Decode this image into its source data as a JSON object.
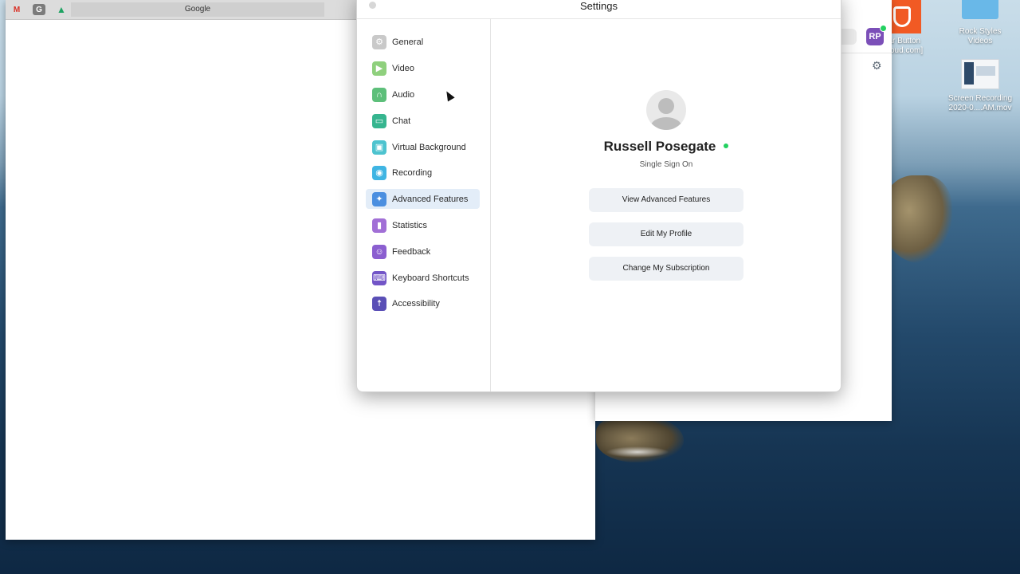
{
  "browser": {
    "bookmarks": [
      {
        "name": "gmail",
        "glyph": "M"
      },
      {
        "name": "g-app",
        "glyph": "G"
      },
      {
        "name": "drive",
        "glyph": "▲"
      }
    ],
    "tab_label": "Google"
  },
  "zoom_main": {
    "avatar_initials": "RP"
  },
  "desktop": {
    "icons": [
      {
        "label": "gar Button\n....oud.com]"
      },
      {
        "label": "Rock Styles\nVideos"
      },
      {
        "label": "Screen Recording\n2020-0....AM.mov"
      }
    ]
  },
  "settings": {
    "title": "Settings",
    "nav": [
      {
        "label": "General",
        "icon": "gear-icon",
        "color": "#c9c9c9",
        "glyph": "⚙"
      },
      {
        "label": "Video",
        "icon": "video-camera-icon",
        "color": "#8fd07d",
        "glyph": "▶"
      },
      {
        "label": "Audio",
        "icon": "headphones-icon",
        "color": "#5dbf7a",
        "glyph": "∩"
      },
      {
        "label": "Chat",
        "icon": "chat-bubble-icon",
        "color": "#36b58f",
        "glyph": "▭"
      },
      {
        "label": "Virtual Background",
        "icon": "person-background-icon",
        "color": "#4dc3cf",
        "glyph": "▣"
      },
      {
        "label": "Recording",
        "icon": "record-icon",
        "color": "#3fb5e3",
        "glyph": "◉"
      },
      {
        "label": "Advanced Features",
        "icon": "sparkle-icon",
        "color": "#4b8fe0",
        "glyph": "✦",
        "active": true
      },
      {
        "label": "Statistics",
        "icon": "bar-chart-icon",
        "color": "#a16fd6",
        "glyph": "▮"
      },
      {
        "label": "Feedback",
        "icon": "smiley-icon",
        "color": "#8b5fd0",
        "glyph": "☺"
      },
      {
        "label": "Keyboard Shortcuts",
        "icon": "keyboard-icon",
        "color": "#7255c7",
        "glyph": "⌨"
      },
      {
        "label": "Accessibility",
        "icon": "accessibility-person-icon",
        "color": "#5a4fb6",
        "glyph": "☨"
      }
    ],
    "profile": {
      "name": "Russell Posegate",
      "login_type": "Single Sign On",
      "status_color": "#23d160"
    },
    "buttons": {
      "view_advanced": "View Advanced Features",
      "edit_profile": "Edit My Profile",
      "change_subscription": "Change My Subscription"
    }
  }
}
